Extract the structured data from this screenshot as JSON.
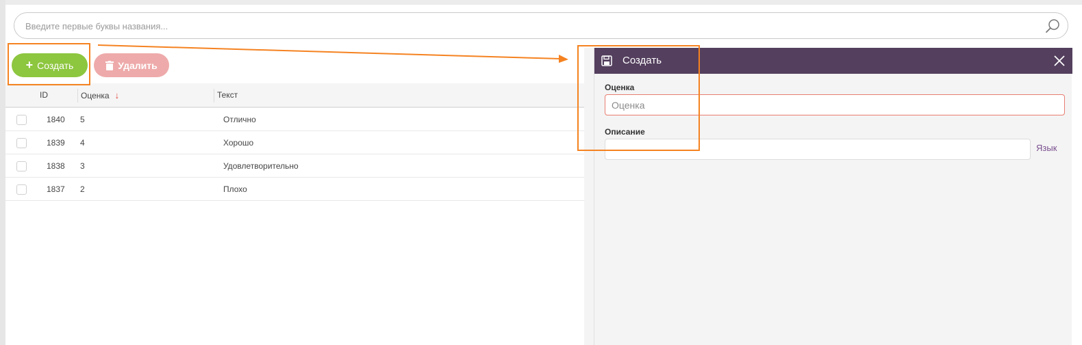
{
  "search": {
    "placeholder": "Введите первые буквы названия..."
  },
  "toolbar": {
    "create_label": "Создать",
    "delete_label": "Удалить"
  },
  "table": {
    "columns": [
      "ID",
      "Оценка",
      "Текст"
    ],
    "rows": [
      {
        "id": "1840",
        "rating": "5",
        "text": "Отлично"
      },
      {
        "id": "1839",
        "rating": "4",
        "text": "Хорошо"
      },
      {
        "id": "1838",
        "rating": "3",
        "text": "Удовлетворительно"
      },
      {
        "id": "1837",
        "rating": "2",
        "text": "Плохо"
      }
    ]
  },
  "panel": {
    "title": "Создать",
    "rating_label": "Оценка",
    "rating_placeholder": "Оценка",
    "description_label": "Описание",
    "language_link": "Язык"
  },
  "colors": {
    "accent_green": "#8dc63f",
    "delete_pink": "#eeaaaa",
    "panel_header": "#543f5e",
    "annotation_orange": "#f58220",
    "sort_arrow_red": "#e0453a"
  },
  "icons": [
    "search-icon",
    "plus-icon",
    "trash-icon",
    "save-icon",
    "close-icon",
    "sort-down-arrow-icon"
  ]
}
